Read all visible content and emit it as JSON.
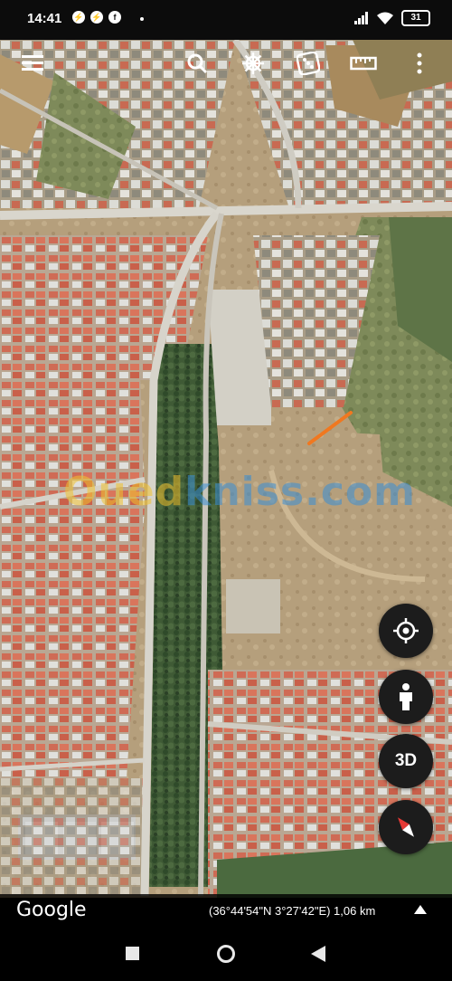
{
  "status_bar": {
    "time": "14:41",
    "notification_icons": [
      "messenger-icon",
      "messenger-icon",
      "facebook-icon"
    ],
    "battery_level": "31"
  },
  "toolbar": {
    "buttons": [
      "menu-icon",
      "search-icon",
      "ship-wheel-icon",
      "dice-icon",
      "ruler-icon",
      "more-vert-icon"
    ]
  },
  "map": {
    "watermark": {
      "part1": "Oued",
      "part2": "kniss",
      "part3": ".com"
    },
    "marker_color": "#f07820"
  },
  "fabs": {
    "locate_icon": "crosshair-icon",
    "streetview_icon": "pegman-icon",
    "view_3d_label": "3D",
    "compass_icon": "compass-icon"
  },
  "info_bar": {
    "logo": "Google",
    "coordinates": "(36°44'54\"N 3°27'42\"E) 1,06 km"
  },
  "nav_bar": {
    "buttons": [
      "recents-square-icon",
      "home-circle-icon",
      "back-triangle-icon"
    ]
  }
}
